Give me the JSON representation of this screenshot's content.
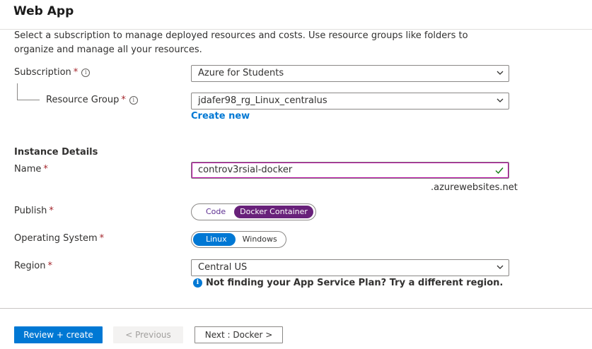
{
  "page": {
    "title": "Web App"
  },
  "description": "Select a subscription to manage deployed resources and costs. Use resource groups like folders to organize and manage all your resources.",
  "subscription": {
    "label": "Subscription",
    "required": "*",
    "value": "Azure for Students"
  },
  "resource_group": {
    "label": "Resource Group",
    "required": "*",
    "value": "jdafer98_rg_Linux_centralus",
    "create_new": "Create new"
  },
  "instance_details": {
    "title": "Instance Details"
  },
  "name_field": {
    "label": "Name",
    "required": "*",
    "value": "controv3rsial-docker",
    "suffix": ".azurewebsites.net"
  },
  "publish": {
    "label": "Publish",
    "required": "*",
    "options": [
      "Code",
      "Docker Container"
    ],
    "selected": "Docker Container"
  },
  "os": {
    "label": "Operating System",
    "required": "*",
    "options": [
      "Linux",
      "Windows"
    ],
    "selected": "Linux"
  },
  "region": {
    "label": "Region",
    "required": "*",
    "value": "Central US",
    "notice": "Not finding your App Service Plan? Try a different region."
  },
  "footer": {
    "review_create": "Review + create",
    "previous": "< Previous",
    "next": "Next : Docker >"
  },
  "icons": {
    "info": "info-icon",
    "chevron": "chevron-down-icon",
    "check": "checkmark-icon",
    "notice": "info-filled-icon"
  },
  "colors": {
    "accent": "#0078d4",
    "publish_selected": "#68217a",
    "required": "#a4262c",
    "valid": "#107c10"
  }
}
